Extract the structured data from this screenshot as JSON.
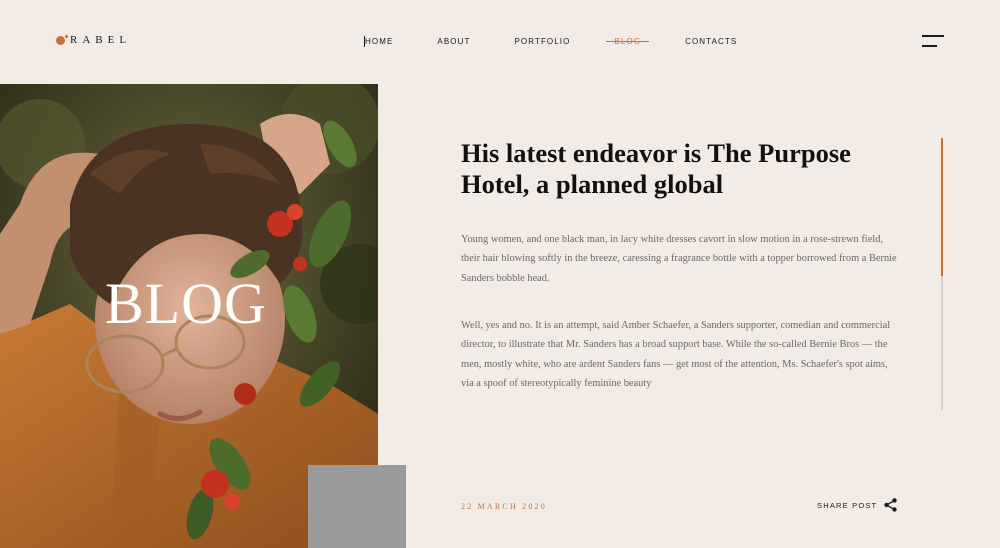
{
  "brand": {
    "name": "RABEL",
    "accent": "#c8703a"
  },
  "nav": {
    "items": [
      {
        "label": "HOME"
      },
      {
        "label": "ABOUT"
      },
      {
        "label": "PORTFOLIO"
      },
      {
        "label": "BLOG"
      },
      {
        "label": "CONTACTS"
      }
    ],
    "active": "BLOG"
  },
  "hero": {
    "title": "BLOG"
  },
  "article": {
    "headline": "His latest endeavor is The Purpose Hotel, a planned global",
    "paragraph_1": "Young women, and one black man, in lacy white dresses cavort in slow motion in a rose-strewn field, their hair blowing softly in the breeze, caressing a fragrance bottle with a topper borrowed from a Bernie Sanders bobble head.",
    "paragraph_2": "Well, yes and no. It is an attempt, said Amber Schaefer, a Sanders supporter, comedian and commercial director, to illustrate that Mr. Sanders has a broad support base. While the so-called Bernie Bros — the men, mostly white, who are ardent Sanders fans — get most of the attention, Ms. Schaefer's spot aims, via a spoof of stereotypically feminine beauty",
    "date": "22 MARCH 2020",
    "share_label": "SHARE POST"
  },
  "icons": {
    "menu": "hamburger-icon",
    "share": "share-icon"
  },
  "colors": {
    "background": "#f2ebe6",
    "accent": "#c8703a",
    "gray_block": "#9a9a9a"
  }
}
